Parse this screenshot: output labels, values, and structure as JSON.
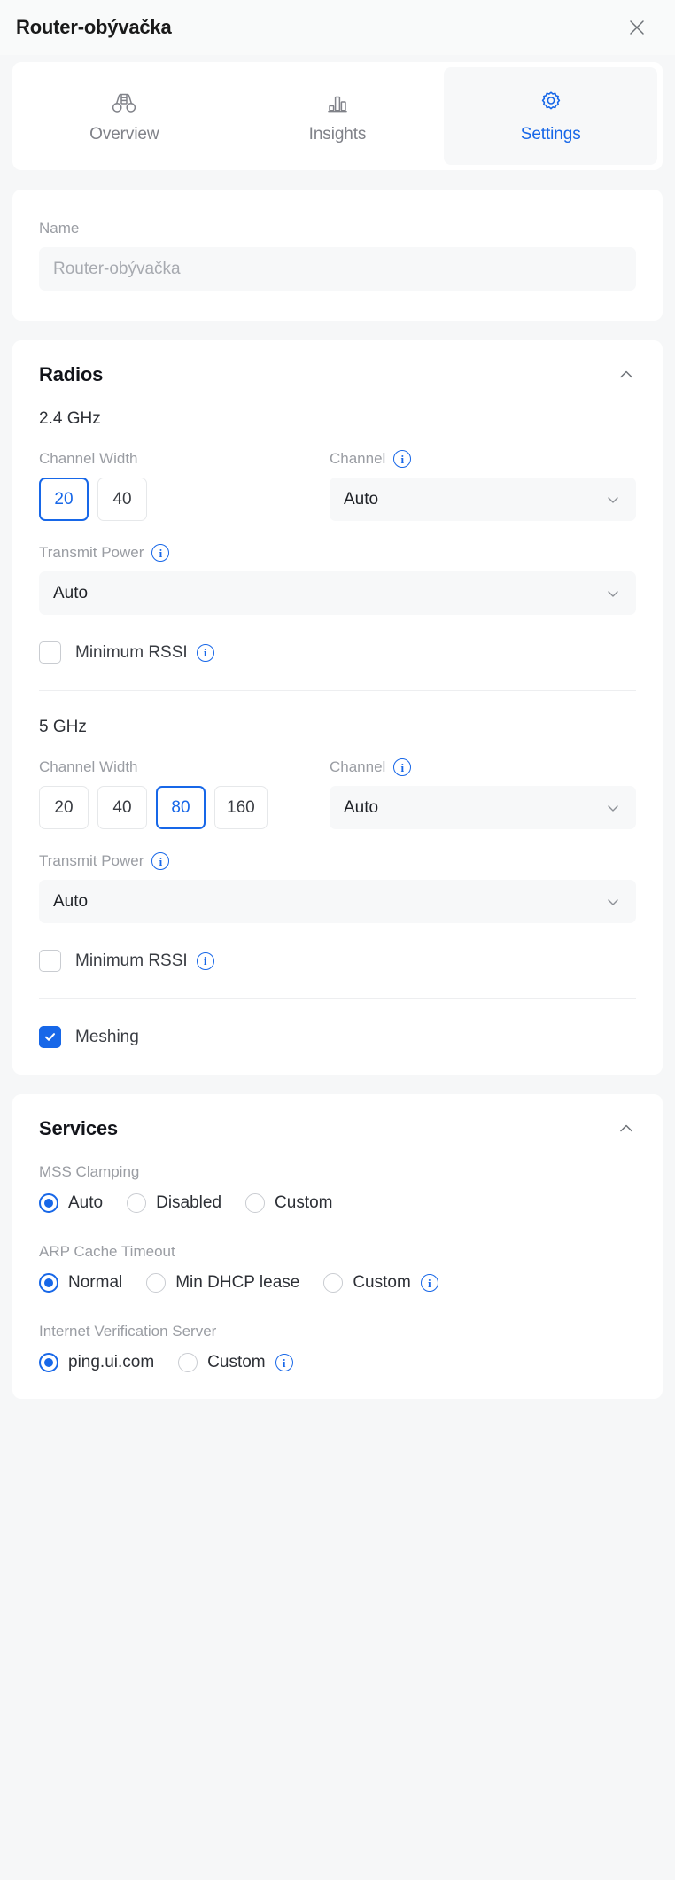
{
  "header": {
    "title": "Router-obývačka",
    "close_icon": "close-icon"
  },
  "tabs": [
    {
      "label": "Overview",
      "icon": "binoculars-icon",
      "active": false
    },
    {
      "label": "Insights",
      "icon": "bar-chart-icon",
      "active": false
    },
    {
      "label": "Settings",
      "icon": "gear-icon",
      "active": true
    }
  ],
  "name_section": {
    "label": "Name",
    "value": "Router-obývačka"
  },
  "radios": {
    "title": "Radios",
    "collapse_icon": "chevron-up-icon",
    "band_24": {
      "band_label": "2.4 GHz",
      "channel_width_label": "Channel Width",
      "channel_width_options": [
        "20",
        "40"
      ],
      "channel_width_selected": "20",
      "channel_label": "Channel",
      "channel_value": "Auto",
      "transmit_power_label": "Transmit Power",
      "transmit_power_value": "Auto",
      "min_rssi_label": "Minimum RSSI",
      "min_rssi_checked": false
    },
    "band_5": {
      "band_label": "5 GHz",
      "channel_width_label": "Channel Width",
      "channel_width_options": [
        "20",
        "40",
        "80",
        "160"
      ],
      "channel_width_selected": "80",
      "channel_label": "Channel",
      "channel_value": "Auto",
      "transmit_power_label": "Transmit Power",
      "transmit_power_value": "Auto",
      "min_rssi_label": "Minimum RSSI",
      "min_rssi_checked": false
    },
    "meshing_label": "Meshing",
    "meshing_checked": true
  },
  "services": {
    "title": "Services",
    "collapse_icon": "chevron-up-icon",
    "mss_clamping": {
      "label": "MSS Clamping",
      "options": [
        "Auto",
        "Disabled",
        "Custom"
      ],
      "selected": "Auto"
    },
    "arp_cache_timeout": {
      "label": "ARP Cache Timeout",
      "options": [
        "Normal",
        "Min DHCP lease",
        "Custom"
      ],
      "selected": "Normal"
    },
    "internet_verification_server": {
      "label": "Internet Verification Server",
      "options": [
        "ping.ui.com",
        "Custom"
      ],
      "selected": "ping.ui.com"
    }
  },
  "colors": {
    "accent": "#1767E8",
    "page_bg": "#F6F7F8",
    "card_bg": "#FFFFFF",
    "muted_text": "#9A9DA3"
  }
}
